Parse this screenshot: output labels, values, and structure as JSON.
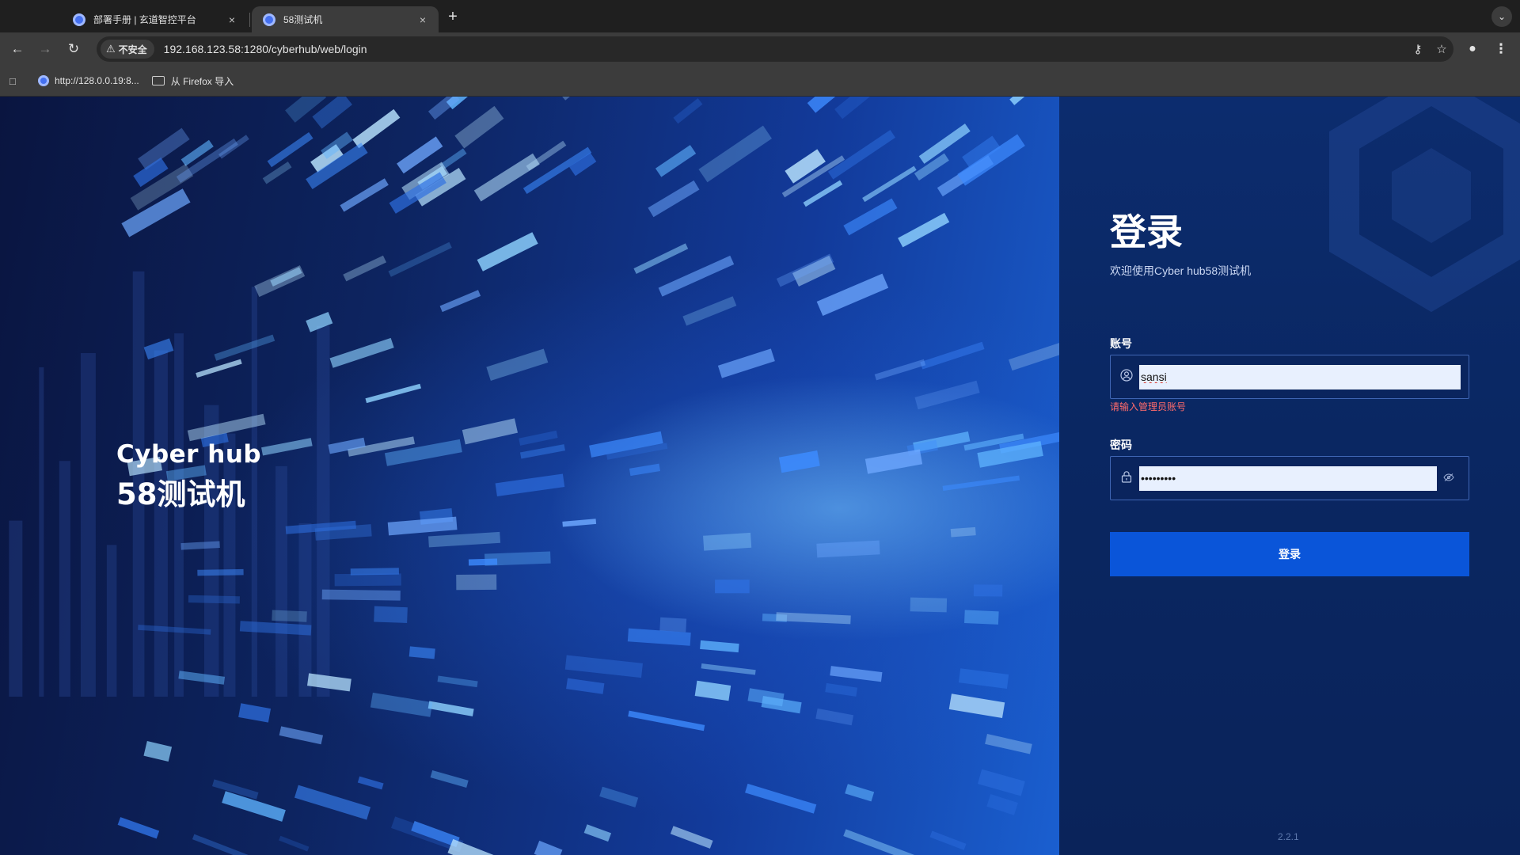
{
  "browser": {
    "tabs": [
      {
        "title": "部署手册 | 玄道智控平台",
        "active": false
      },
      {
        "title": "58测试机",
        "active": true
      }
    ],
    "new_tab_icon": "+",
    "tab_close_icon": "×",
    "security_label": "不安全",
    "url": "192.168.123.58:1280/cyberhub/web/login",
    "bookmarks": [
      {
        "label": "http://128.0.0.19:8...",
        "type": "link"
      },
      {
        "label": "从 Firefox 导入",
        "type": "folder"
      }
    ]
  },
  "hero": {
    "line1": "Cyber hub",
    "line2": "58测试机"
  },
  "login": {
    "title": "登录",
    "subtitle": "欢迎使用Cyber hub58测试机",
    "account_label": "账号",
    "account_value": "sansi",
    "account_error": "请输入管理员账号",
    "password_label": "密码",
    "password_value": "sansi1234",
    "submit_label": "登录",
    "version": "2.2.1"
  },
  "colors": {
    "primary_button": "#0a55d9",
    "panel_bg": "#0a2762",
    "error": "#ff6b6b"
  }
}
